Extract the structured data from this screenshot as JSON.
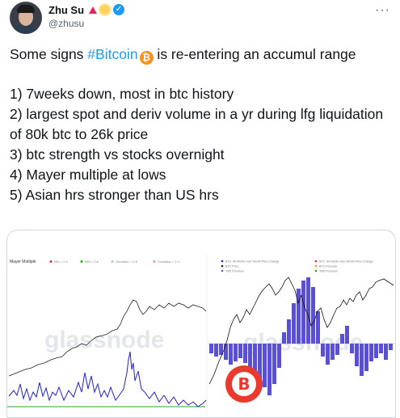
{
  "author": {
    "display_name": "Zhu Su",
    "handle": "@zhusu"
  },
  "icons": {
    "verified": "verified-badge-icon",
    "more": "more-dots-icon",
    "bitcoin": "bitcoin-emoji"
  },
  "colors": {
    "link": "#1d9bf0",
    "text": "#0f1419",
    "secondary": "#536471",
    "chart_blue": "#1f1fcc",
    "chart_green": "#22aa22",
    "chart_purple": "#6a5acd"
  },
  "tweet": {
    "line1_pre": "Some signs ",
    "hashtag": "#Bitcoin",
    "btc_glyph": "₿",
    "line1_post": "  is re-entering an accumul range",
    "points": [
      "1) 7weeks down, most in btc history",
      "2) largest spot and deriv volume in a yr during lfg liquidation of 80k btc to 26k price",
      "3) btc strength vs stocks overnight",
      "4) Mayer multiple at lows",
      "5) Asian hrs stronger than US hrs"
    ]
  },
  "media": {
    "left_chart": {
      "title": "Mayer Multiple",
      "legend": [
        "MM = 2.4",
        "MM = 0.8",
        "Oscillator = 0.8",
        "Oscillator = 2.4"
      ],
      "watermark": "glassnode"
    },
    "right_chart": {
      "legend": [
        "BTC: 60-Month-over-Month Price Change",
        "BTC Price",
        "TBD Premium",
        "BTC: 60-Month-over-Month Price Change",
        "BTC Forecast",
        "TBD Premium"
      ],
      "watermark": "glassnode"
    },
    "badge_text": "B"
  }
}
